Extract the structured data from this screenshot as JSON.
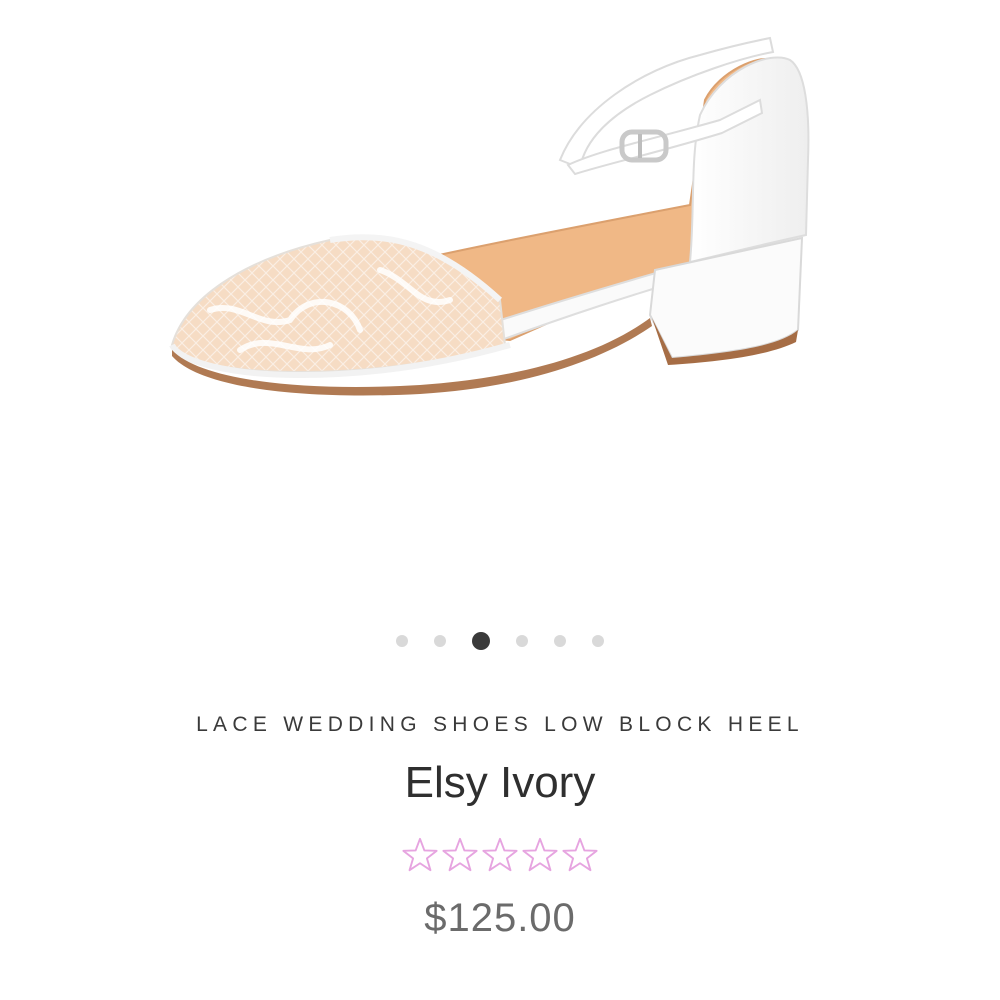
{
  "product": {
    "category": "LACE WEDDING SHOES LOW BLOCK HEEL",
    "title": "Elsy Ivory",
    "price": "$125.00",
    "rating": {
      "filled": 0,
      "max": 5,
      "icon": "star-outline-icon",
      "color": "#e6a4e0"
    },
    "image": {
      "icon": "lace-block-heel-shoe-image"
    }
  },
  "carousel": {
    "total": 6,
    "active_index": 2
  }
}
